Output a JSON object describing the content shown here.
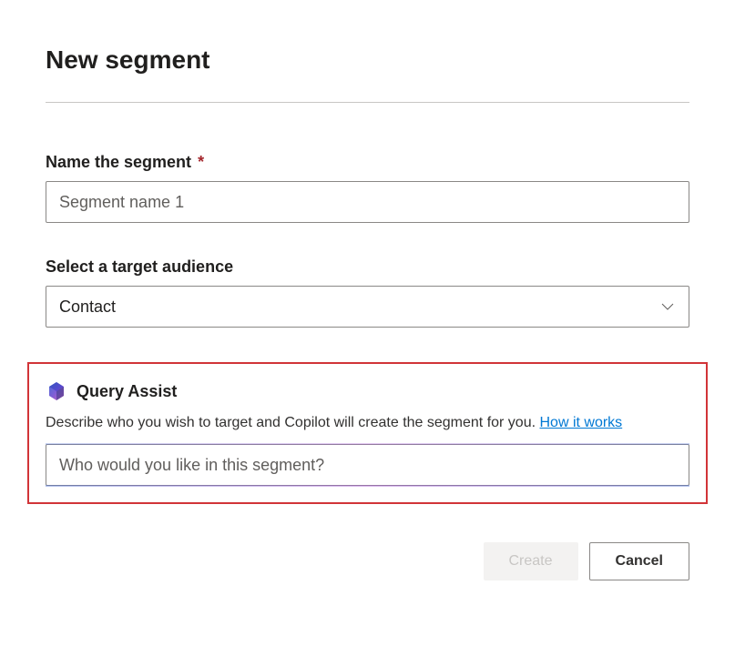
{
  "page": {
    "title": "New segment"
  },
  "fields": {
    "segment_name": {
      "label": "Name the segment",
      "required_mark": "*",
      "value": "Segment name 1"
    },
    "target_audience": {
      "label": "Select a target audience",
      "value": "Contact"
    }
  },
  "query_assist": {
    "title": "Query Assist",
    "description": "Describe who you wish to target and Copilot will create the segment for you. ",
    "link_text": "How it works",
    "placeholder": "Who would you like in this segment?"
  },
  "buttons": {
    "create": "Create",
    "cancel": "Cancel"
  }
}
